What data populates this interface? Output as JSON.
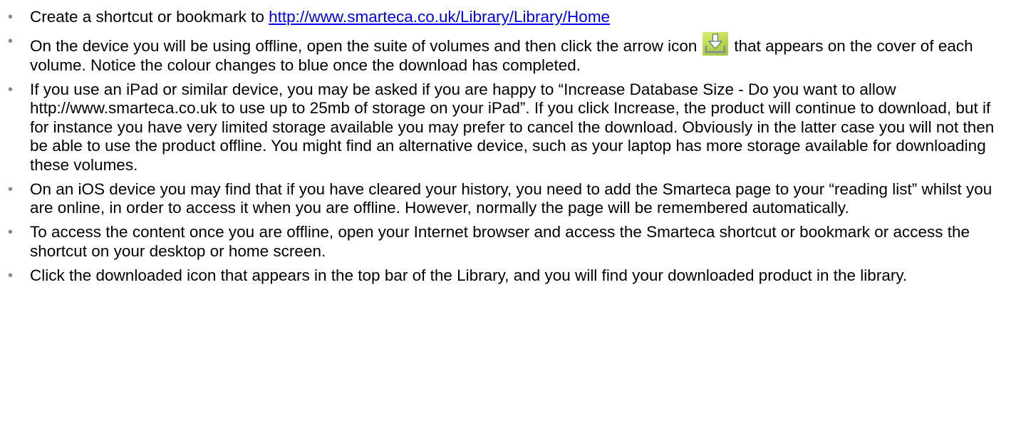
{
  "bullet_glyph": "•",
  "items": [
    {
      "before": "Create a shortcut or bookmark to ",
      "link": "http://www.smarteca.co.uk/Library/Library/Home"
    },
    {
      "before": "On the device you will be using offline, open the suite of volumes and then click the arrow icon",
      "icon": "download-arrow-icon",
      "after": "that appears on the cover of each volume. Notice the colour changes to blue once the download has completed."
    },
    {
      "text": "If you use an iPad or similar device, you may be asked if you are happy to “Increase Database Size - Do you want to allow http://www.smarteca.co.uk to use up to 25mb of storage on your iPad”. If you click Increase, the product will continue to download, but if for instance you have very limited storage available you may prefer to cancel the download. Obviously in the latter case you will not then be able to use the product offline. You might find an alternative device, such as your laptop has more storage available for downloading these volumes."
    },
    {
      "text": "On an iOS device you may find that if you have cleared your history, you need to add the Smarteca page to your “reading list” whilst you are online, in order to access it when you are offline. However, normally the page will be remembered automatically."
    },
    {
      "text": "To access the content once you are offline, open your Internet browser and access the Smarteca shortcut or bookmark or access the shortcut on your desktop or home screen."
    },
    {
      "text": "Click the downloaded icon that appears in the top bar of the Library, and you will find your downloaded product in the library."
    }
  ]
}
